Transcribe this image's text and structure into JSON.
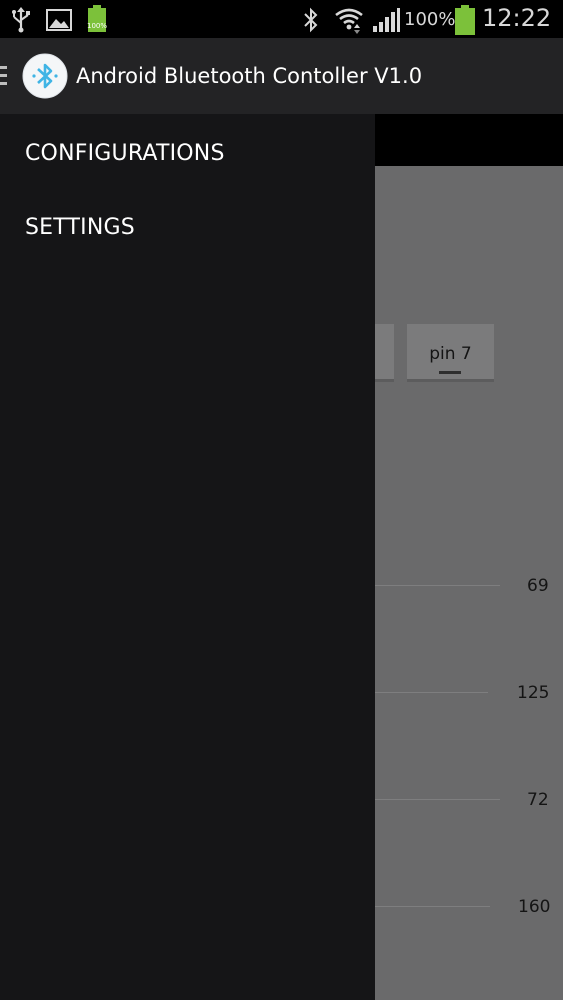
{
  "status_bar": {
    "battery_small_label": "100%",
    "battery_percent": "100%",
    "time": "12:22",
    "icons": [
      "usb-icon",
      "gallery-icon",
      "battery-small-icon",
      "bluetooth-icon",
      "wifi-icon",
      "signal-icon",
      "battery-icon"
    ]
  },
  "action_bar": {
    "title": "Android Bluetooth Contoller V1.0",
    "logo_icon": "bluetooth-logo-icon"
  },
  "drawer": {
    "items": [
      {
        "label": "CONFIGURATIONS"
      },
      {
        "label": "SETTINGS"
      }
    ]
  },
  "content": {
    "pin_button": {
      "label": "pin 7"
    },
    "sliders": [
      {
        "value": "69"
      },
      {
        "value": "125"
      },
      {
        "value": "72"
      },
      {
        "value": "160"
      }
    ]
  },
  "colors": {
    "action_bar_bg": "#232325",
    "drawer_bg": "#151517",
    "content_dim": "#6a6a6b",
    "battery_green": "#7cc13a",
    "bluetooth_blue": "#3fb4e5"
  }
}
